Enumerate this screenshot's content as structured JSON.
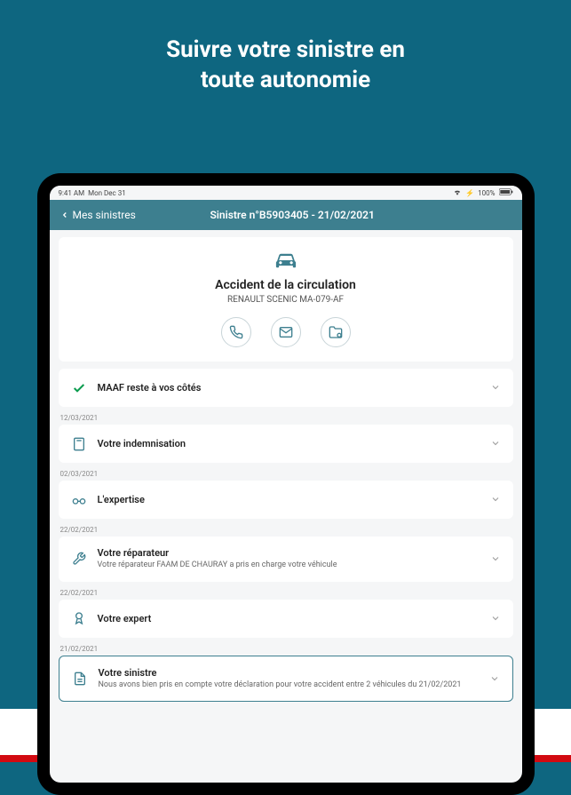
{
  "promo": {
    "line1": "Suivre votre sinistre en",
    "line2": "toute autonomie"
  },
  "statusbar": {
    "time": "9:41 AM",
    "date": "Mon Dec 31",
    "battery": "100%"
  },
  "header": {
    "back": "Mes sinistres",
    "title": "Sinistre n°B5903405 - 21/02/2021"
  },
  "summary": {
    "title": "Accident de la circulation",
    "vehicle": "RENAULT SCENIC MA-079-AF"
  },
  "steps": [
    {
      "date": "",
      "title": "MAAF reste à vos côtés",
      "desc": "",
      "icon": "check"
    },
    {
      "date": "12/03/2021",
      "title": "Votre indemnisation",
      "desc": "",
      "icon": "calculator"
    },
    {
      "date": "02/03/2021",
      "title": "L'expertise",
      "desc": "",
      "icon": "glasses"
    },
    {
      "date": "22/02/2021",
      "title": "Votre réparateur",
      "desc": "Votre réparateur FAAM DE CHAURAY a pris en charge votre véhicule",
      "icon": "wrench"
    },
    {
      "date": "22/02/2021",
      "title": "Votre expert",
      "desc": "",
      "icon": "badge"
    },
    {
      "date": "21/02/2021",
      "title": "Votre sinistre",
      "desc": "Nous avons bien pris en compte votre déclaration pour votre accident entre 2 véhicules du 21/02/2021",
      "icon": "document",
      "current": true
    }
  ]
}
